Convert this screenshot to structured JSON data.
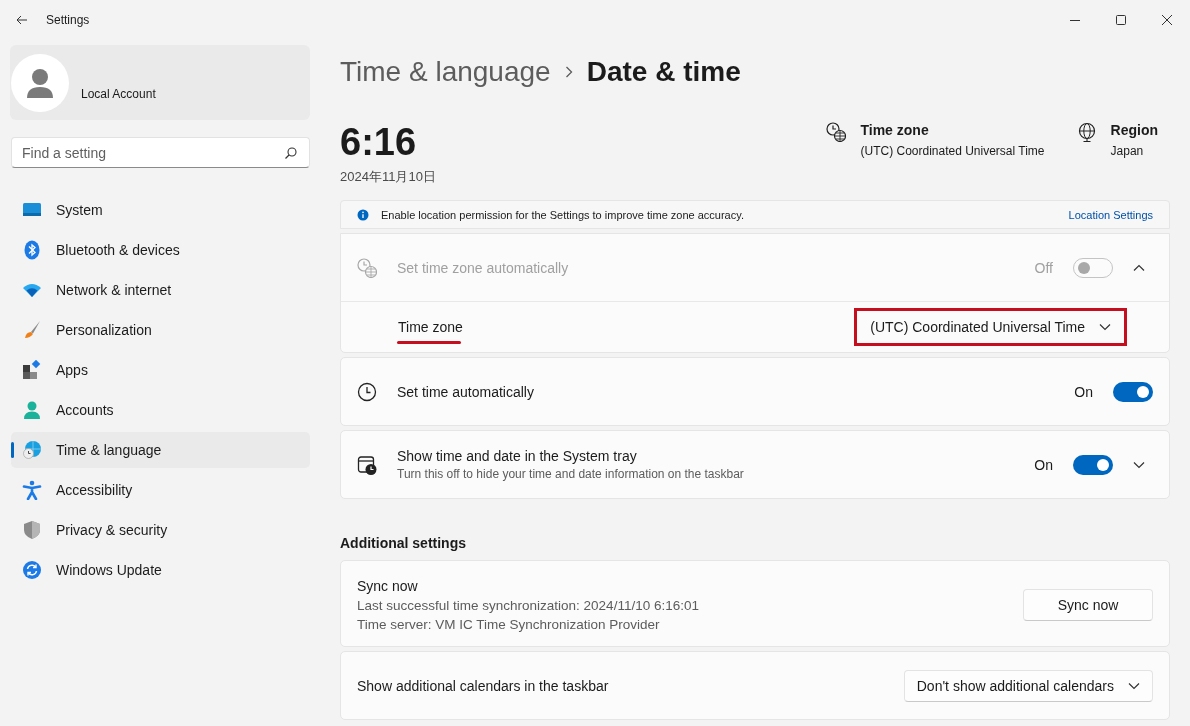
{
  "window": {
    "title": "Settings"
  },
  "account": {
    "name": "Local Account"
  },
  "search": {
    "placeholder": "Find a setting"
  },
  "nav": [
    {
      "kind": "system",
      "label": "System",
      "selected": false
    },
    {
      "kind": "bluetooth",
      "label": "Bluetooth & devices",
      "selected": false
    },
    {
      "kind": "network",
      "label": "Network & internet",
      "selected": false
    },
    {
      "kind": "personalization",
      "label": "Personalization",
      "selected": false
    },
    {
      "kind": "apps",
      "label": "Apps",
      "selected": false
    },
    {
      "kind": "accounts",
      "label": "Accounts",
      "selected": false
    },
    {
      "kind": "time",
      "label": "Time & language",
      "selected": true
    },
    {
      "kind": "accessibility",
      "label": "Accessibility",
      "selected": false
    },
    {
      "kind": "privacy",
      "label": "Privacy & security",
      "selected": false
    },
    {
      "kind": "update",
      "label": "Windows Update",
      "selected": false
    }
  ],
  "breadcrumb": {
    "parent": "Time & language",
    "current": "Date & time"
  },
  "clock": {
    "time": "6:16",
    "date": "2024年11月10日"
  },
  "summary": [
    {
      "kind": "timezone",
      "title": "Time zone",
      "value": "(UTC) Coordinated Universal Time"
    },
    {
      "kind": "region",
      "title": "Region",
      "value": "Japan"
    }
  ],
  "notice": {
    "text": "Enable location permission for the Settings to improve time zone accuracy.",
    "link": "Location Settings"
  },
  "cards": [
    {
      "kind": "clock-globe",
      "title": "Set time zone automatically",
      "disabled": true,
      "on": false,
      "state_label": "Off",
      "expanded": true,
      "children": [
        {
          "label": "Time zone",
          "value": "(UTC) Coordinated Universal Time",
          "highlighted": true
        }
      ]
    },
    {
      "kind": "clock",
      "title": "Set time automatically",
      "disabled": false,
      "on": true,
      "state_label": "On"
    },
    {
      "kind": "calendar-clock",
      "title": "Show time and date in the System tray",
      "subtitle": "Turn this off to hide your time and date information on the taskbar",
      "disabled": false,
      "on": true,
      "state_label": "On",
      "expanded": false
    }
  ],
  "additional": {
    "heading": "Additional settings",
    "cards": [
      {
        "kind": "sync",
        "title": "Sync now",
        "lines": [
          "Last successful time synchronization: 2024/11/10 6:16:01",
          "Time server: VM IC Time Synchronization Provider"
        ],
        "button": "Sync now"
      },
      {
        "kind": "dropdown",
        "title": "Show additional calendars in the taskbar",
        "value": "Don't show additional calendars"
      }
    ]
  }
}
